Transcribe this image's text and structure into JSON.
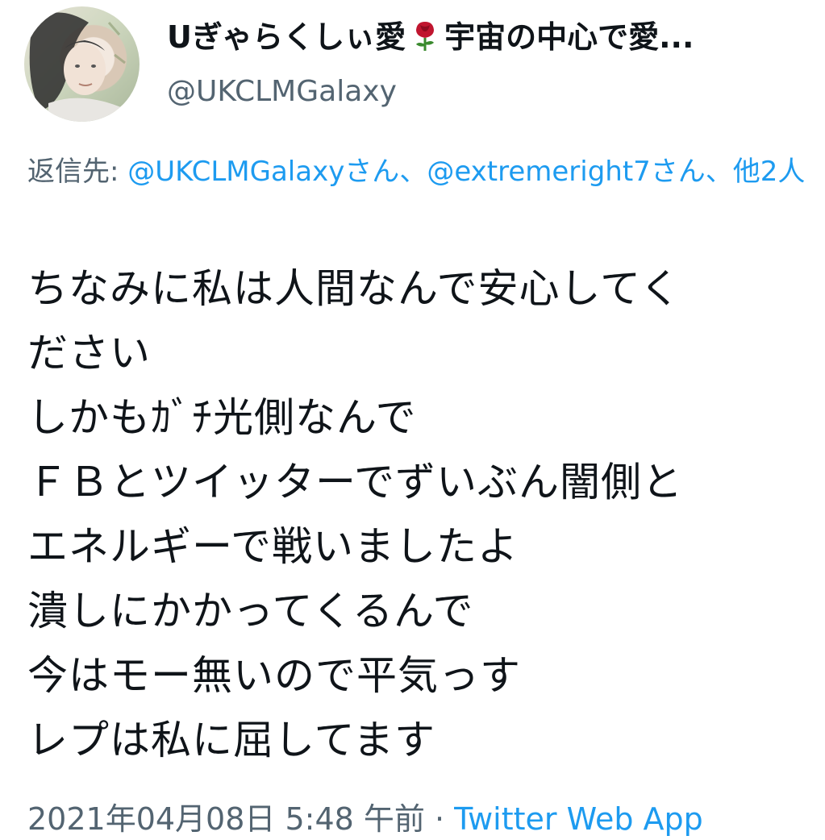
{
  "colors": {
    "link": "#1d9bf0",
    "muted": "#536471",
    "text": "#0f1419"
  },
  "user": {
    "display_name_part1": "Uぎゃらくしぃ愛",
    "emoji_icon": "rose-icon",
    "display_name_part2": "宇宙の中心で愛...",
    "handle": "@UKCLMGalaxy"
  },
  "reply": {
    "prefix": "返信先: ",
    "mention1": "@UKCLMGalaxyさん",
    "sep1": "、",
    "mention2": "@extremeright7さん",
    "sep2": "、",
    "others": "他2人"
  },
  "tweet": {
    "lines": [
      "ちなみに私は人間なんで安心してく",
      "ださい",
      "しかもｶﾞﾁ光側なんで",
      "ＦＢとツイッターでずいぶん闇側と",
      "エネルギーで戦いましたよ",
      "潰しにかかってくるんで",
      "今はモー無いので平気っす",
      "レプは私に屈してます"
    ]
  },
  "meta": {
    "timestamp": "2021年04月08日 5:48 午前",
    "separator": " · ",
    "source": "Twitter Web App"
  }
}
